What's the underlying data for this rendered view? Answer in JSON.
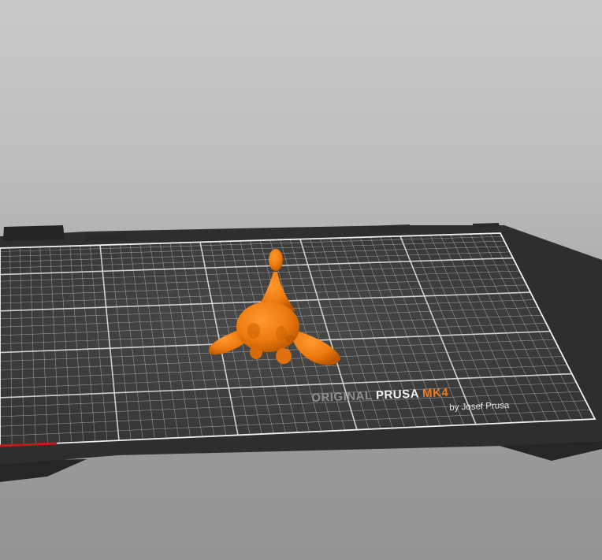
{
  "bed": {
    "brand_prefix": "ORIGINAL",
    "brand_name": "PRUSA",
    "brand_model": "MK4",
    "byline": "by Josef Prusa"
  },
  "colors": {
    "background_top": "#c9c9c9",
    "background_bottom": "#949494",
    "bed_frame": "#2b2b2b",
    "bed_surface": "#3d3d3d",
    "grid_lines": "#e6e6e6",
    "model": "#ee7a0e",
    "model_shadow": "#b85700",
    "brand_accent": "#f07a1f",
    "x_axis": "#c41a1a"
  },
  "icons": [
    "print-bed-icon",
    "model-object-icon",
    "x-axis-indicator-icon"
  ]
}
